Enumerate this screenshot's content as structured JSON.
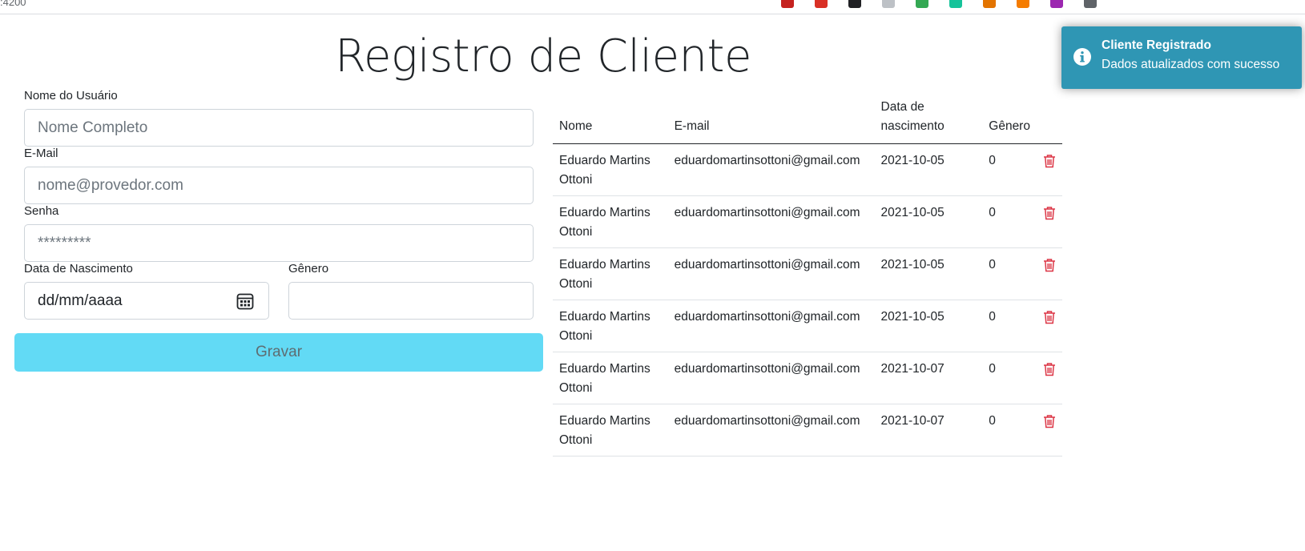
{
  "browser": {
    "url": ":4200",
    "extensions": [
      {
        "name": "pdf-extension-icon",
        "color": "#c5221f"
      },
      {
        "name": "red-extension-icon",
        "color": "#d93025"
      },
      {
        "name": "dark-extension-icon",
        "color": "#202124"
      },
      {
        "name": "grey-extension-icon",
        "color": "#bdc1c6"
      },
      {
        "name": "green-extension-icon",
        "color": "#34a853"
      },
      {
        "name": "grammarly-icon",
        "color": "#15c39a"
      },
      {
        "name": "tool-extension-icon",
        "color": "#e37400"
      },
      {
        "name": "orange-extension-icon",
        "color": "#f57c00"
      },
      {
        "name": "purple-extension-icon",
        "color": "#9c27b0"
      },
      {
        "name": "notion-icon",
        "color": "#5f6368"
      }
    ]
  },
  "page": {
    "title": "Registro de Cliente"
  },
  "form": {
    "name_label": "Nome do Usuário",
    "name_placeholder": "Nome Completo",
    "email_label": "E-Mail",
    "email_placeholder": "nome@provedor.com",
    "password_label": "Senha",
    "password_placeholder": "*********",
    "birthdate_label": "Data de Nascimento",
    "birthdate_value": "dd/mm/aaaa",
    "gender_label": "Gênero",
    "gender_value": "",
    "save_label": "Gravar"
  },
  "table": {
    "headers": {
      "nome": "Nome",
      "email": "E-mail",
      "date": "Data de nascimento",
      "gender": "Gênero"
    },
    "rows": [
      {
        "nome": "Eduardo Martins Ottoni",
        "email": "eduardomartinsottoni@gmail.com",
        "date": "2021-10-05",
        "gender": "0"
      },
      {
        "nome": "Eduardo Martins Ottoni",
        "email": "eduardomartinsottoni@gmail.com",
        "date": "2021-10-05",
        "gender": "0"
      },
      {
        "nome": "Eduardo Martins Ottoni",
        "email": "eduardomartinsottoni@gmail.com",
        "date": "2021-10-05",
        "gender": "0"
      },
      {
        "nome": "Eduardo Martins Ottoni",
        "email": "eduardomartinsottoni@gmail.com",
        "date": "2021-10-05",
        "gender": "0"
      },
      {
        "nome": "Eduardo Martins Ottoni",
        "email": "eduardomartinsottoni@gmail.com",
        "date": "2021-10-07",
        "gender": "0"
      },
      {
        "nome": "Eduardo Martins Ottoni",
        "email": "eduardomartinsottoni@gmail.com",
        "date": "2021-10-07",
        "gender": "0"
      }
    ]
  },
  "toast": {
    "title": "Cliente Registrado",
    "message": "Dados atualizados com sucesso",
    "icon": "info-icon",
    "color": "#2f96b4"
  },
  "colors": {
    "save_button": "#62daf5",
    "delete_icon": "#dc3545"
  }
}
